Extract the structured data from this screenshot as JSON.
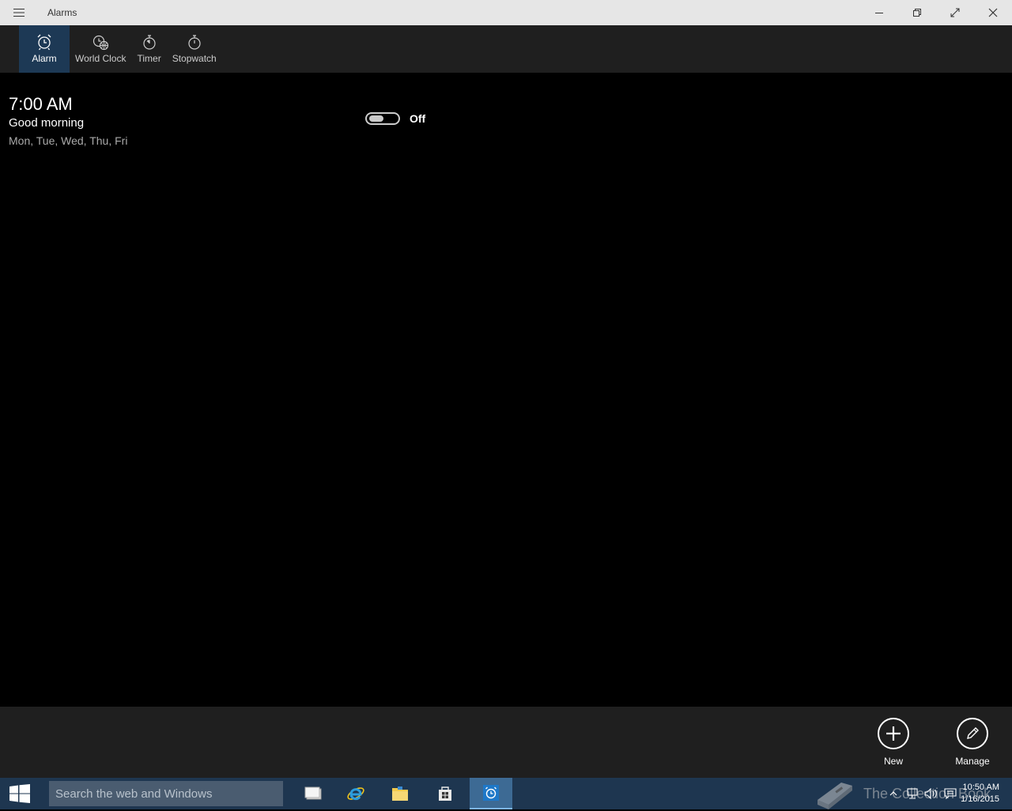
{
  "window": {
    "title": "Alarms"
  },
  "nav": {
    "tabs": [
      {
        "label": "Alarm",
        "icon": "alarm-clock-icon",
        "active": true
      },
      {
        "label": "World Clock",
        "icon": "world-clock-icon",
        "active": false
      },
      {
        "label": "Timer",
        "icon": "timer-icon",
        "active": false
      },
      {
        "label": "Stopwatch",
        "icon": "stopwatch-icon",
        "active": false
      }
    ]
  },
  "alarms": [
    {
      "time": "7:00 AM",
      "name": "Good morning",
      "days": "Mon, Tue, Wed, Thu, Fri",
      "state_label": "Off",
      "enabled": false
    }
  ],
  "commands": {
    "new_label": "New",
    "manage_label": "Manage"
  },
  "taskbar": {
    "search_placeholder": "Search the web and Windows",
    "apps": [
      "task-view-icon",
      "internet-explorer-icon",
      "file-explorer-icon",
      "store-icon",
      "alarms-app-icon"
    ],
    "clock_time": "10:50 AM",
    "clock_date": "1/16/2015",
    "watermark": "The Collection Book"
  },
  "colors": {
    "accent": "#1d3955",
    "taskbar": "#1e3650",
    "bar": "#1f1f1f"
  }
}
